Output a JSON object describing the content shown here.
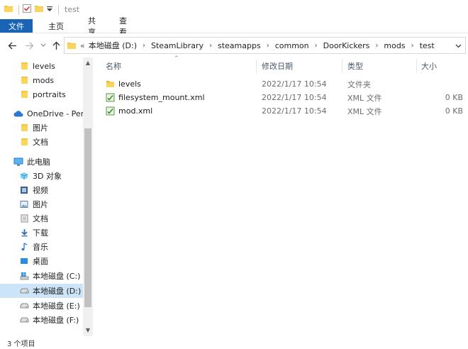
{
  "window": {
    "title": "test"
  },
  "ribbon": {
    "tabs": [
      {
        "label": "文件"
      },
      {
        "label": "主页"
      },
      {
        "label": "共享"
      },
      {
        "label": "查看"
      }
    ]
  },
  "address": {
    "overflow": "«",
    "segments": [
      "本地磁盘 (D:)",
      "SteamLibrary",
      "steamapps",
      "common",
      "DoorKickers",
      "mods",
      "test"
    ]
  },
  "sidebar": {
    "items": [
      {
        "label": "levels",
        "icon": "folder-icon"
      },
      {
        "label": "mods",
        "icon": "folder-icon"
      },
      {
        "label": "portraits",
        "icon": "folder-icon"
      },
      {
        "label": "OneDrive - Perso",
        "icon": "cloud-icon"
      },
      {
        "label": "图片",
        "icon": "folder-icon"
      },
      {
        "label": "文档",
        "icon": "folder-icon"
      },
      {
        "label": "此电脑",
        "icon": "computer-icon"
      },
      {
        "label": "3D 对象",
        "icon": "cube-icon"
      },
      {
        "label": "视频",
        "icon": "video-icon"
      },
      {
        "label": "图片",
        "icon": "pictures-icon"
      },
      {
        "label": "文档",
        "icon": "document-icon"
      },
      {
        "label": "下载",
        "icon": "download-icon"
      },
      {
        "label": "音乐",
        "icon": "music-icon"
      },
      {
        "label": "桌面",
        "icon": "desktop-icon"
      },
      {
        "label": "本地磁盘 (C:)",
        "icon": "windows-drive-icon"
      },
      {
        "label": "本地磁盘 (D:)",
        "icon": "drive-icon",
        "selected": true
      },
      {
        "label": "本地磁盘 (E:)",
        "icon": "drive-icon"
      },
      {
        "label": "本地磁盘 (F:)",
        "icon": "drive-icon"
      }
    ]
  },
  "columns": {
    "name": "名称",
    "date": "修改日期",
    "type": "类型",
    "size": "大小"
  },
  "files": [
    {
      "name": "levels",
      "date": "2022/1/17 10:54",
      "type": "文件夹",
      "size": "",
      "icon": "folder-icon"
    },
    {
      "name": "filesystem_mount.xml",
      "date": "2022/1/17 10:54",
      "type": "XML 文件",
      "size": "0 KB",
      "icon": "xml-file-icon"
    },
    {
      "name": "mod.xml",
      "date": "2022/1/17 10:54",
      "type": "XML 文件",
      "size": "0 KB",
      "icon": "xml-file-icon"
    }
  ],
  "status": {
    "item_count": "3 个项目"
  },
  "colors": {
    "accent": "#1a64b6",
    "folder": "#f5c542",
    "selection": "#cce4f7"
  }
}
